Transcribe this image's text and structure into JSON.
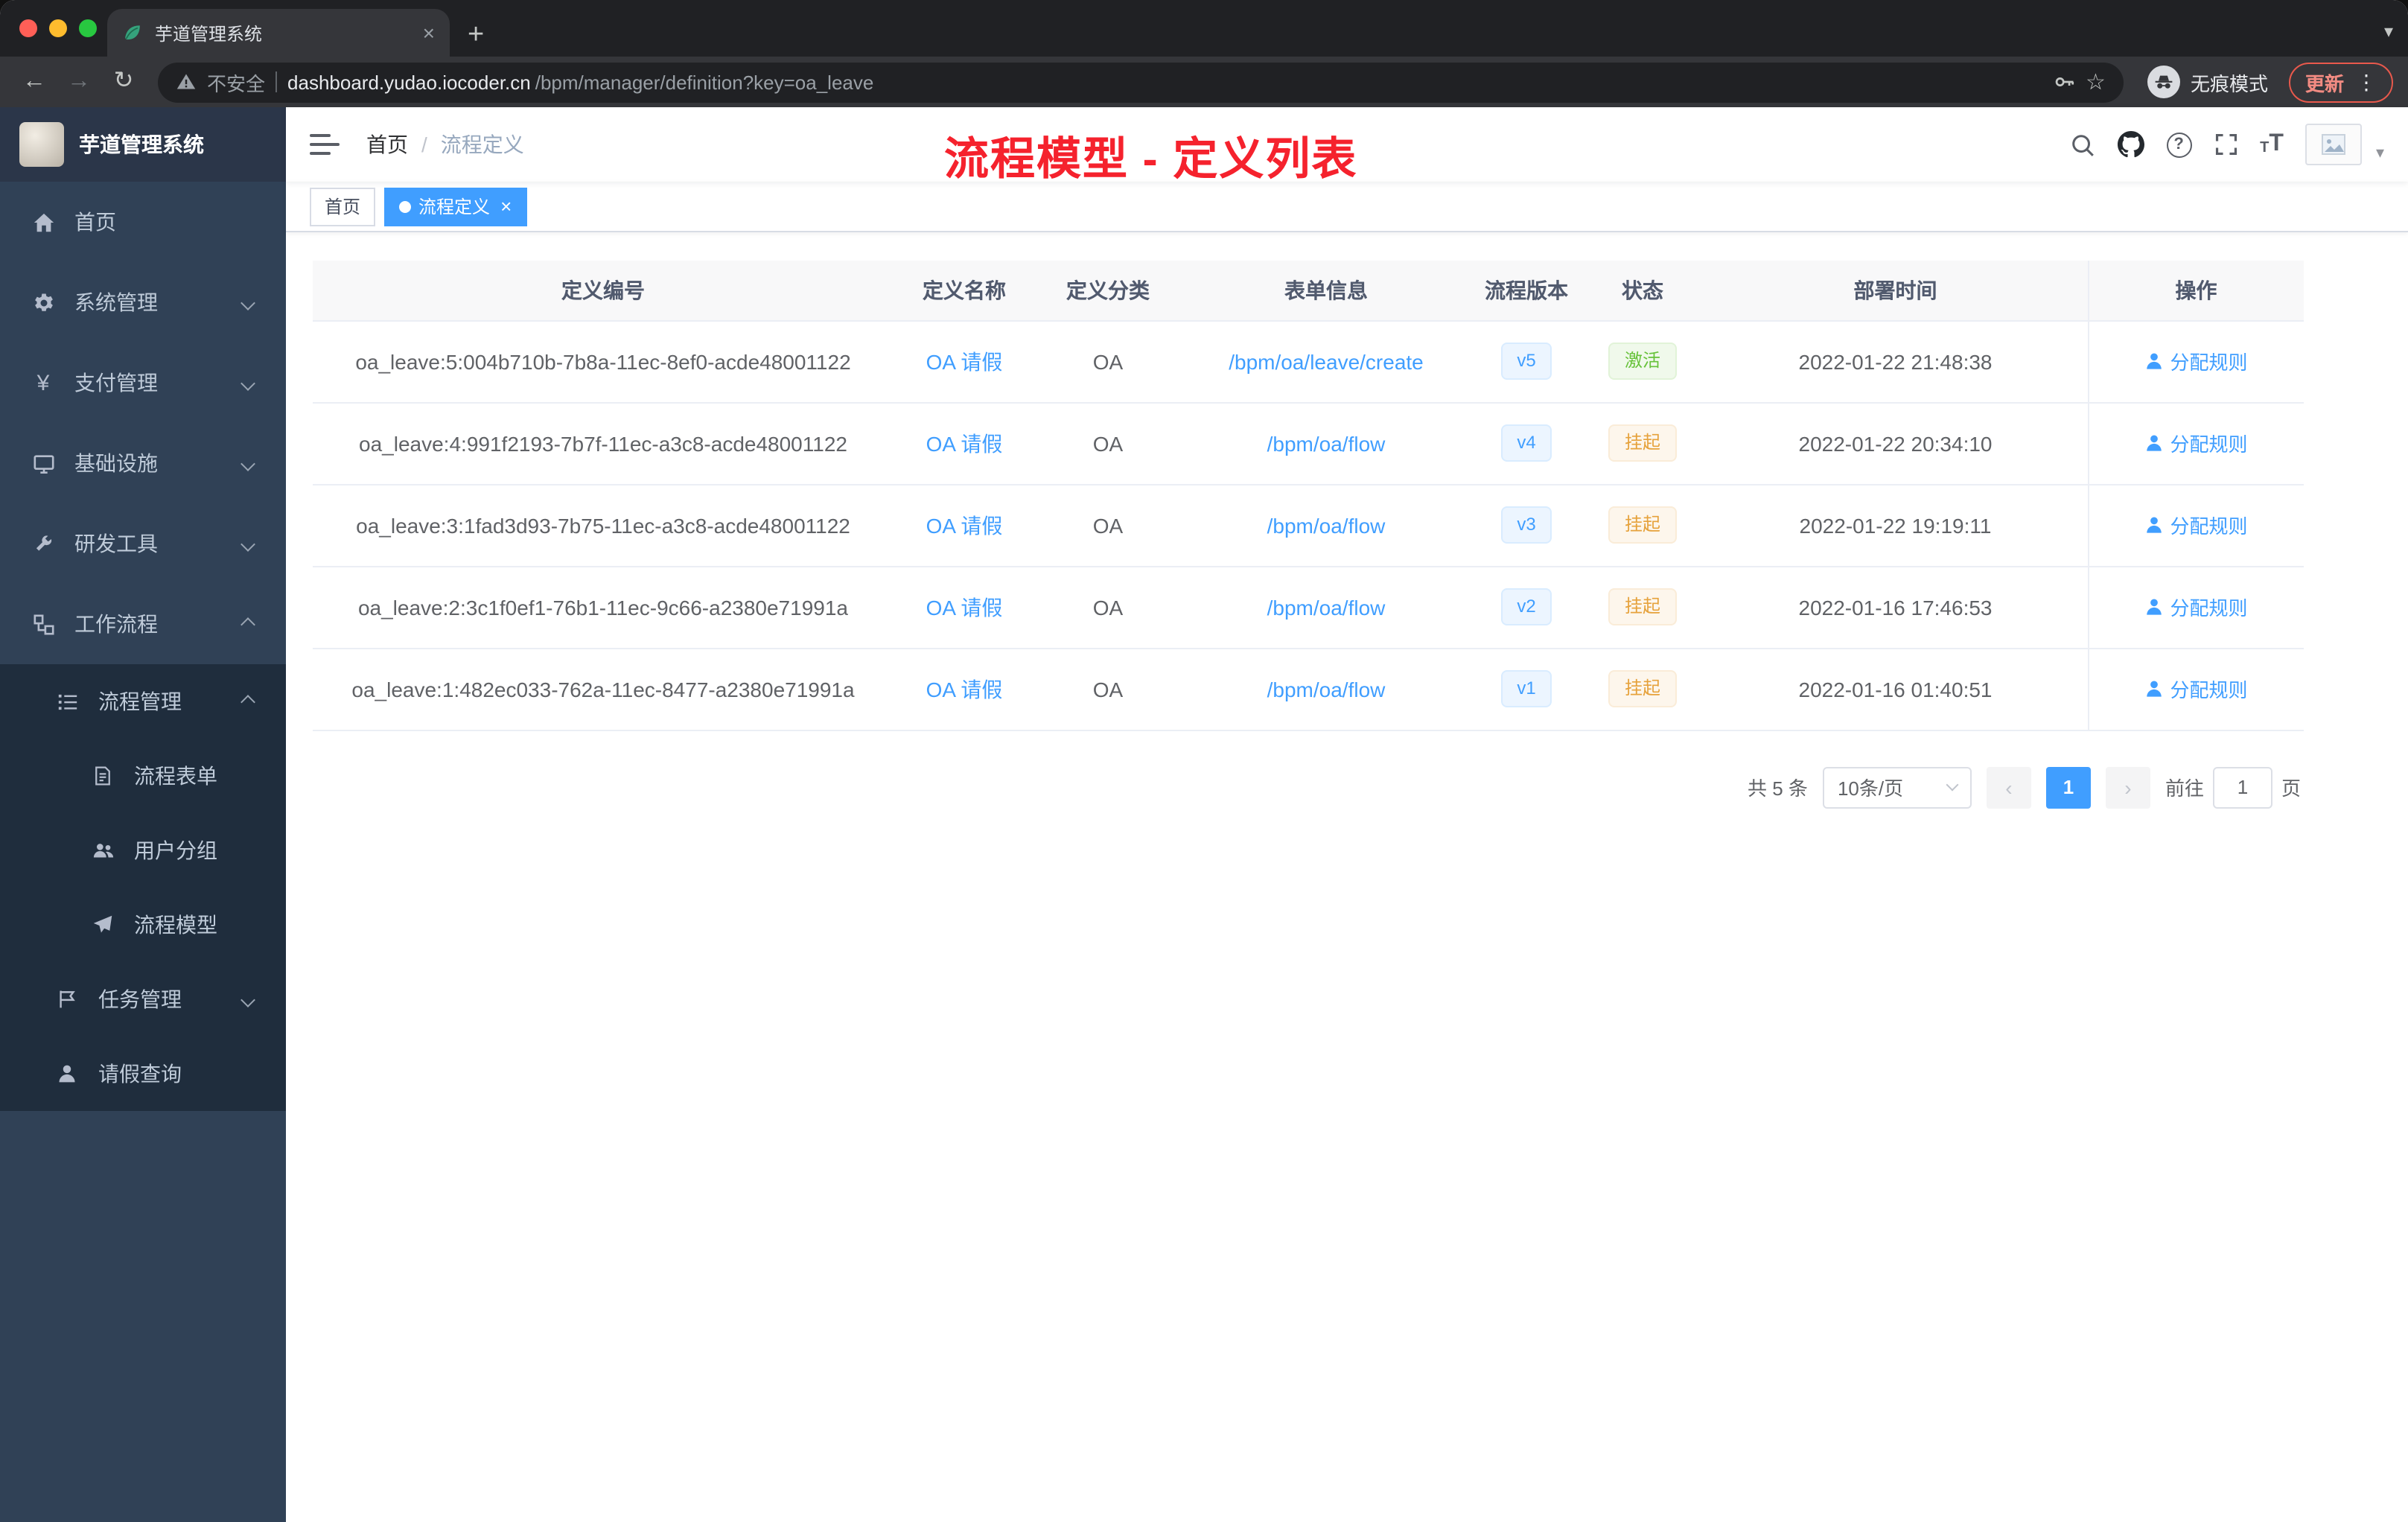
{
  "browser": {
    "tab_title": "芋道管理系统",
    "security_label": "不安全",
    "url_host": "dashboard.yudao.iocoder.cn",
    "url_path": "/bpm/manager/definition?key=oa_leave",
    "incognito_label": "无痕模式",
    "update_label": "更新"
  },
  "glyphs": {
    "back": "←",
    "forward": "→",
    "reload": "↻",
    "plus": "+",
    "close": "×",
    "dots": "⋮",
    "caret": "▾",
    "yen": "¥",
    "star": "☆",
    "question": "?",
    "prev": "‹",
    "next": "›",
    "font_small": "T",
    "font_large": "T"
  },
  "sidebar": {
    "logo_title": "芋道管理系统",
    "menu": {
      "home": "首页",
      "system": "系统管理",
      "payment": "支付管理",
      "infra": "基础设施",
      "devtools": "研发工具",
      "workflow": "工作流程",
      "process_mgmt": "流程管理",
      "process_form": "流程表单",
      "user_group": "用户分组",
      "process_model": "流程模型",
      "task_mgmt": "任务管理",
      "leave_query": "请假查询"
    }
  },
  "navbar": {
    "breadcrumb_home": "首页",
    "breadcrumb_sep": "/",
    "breadcrumb_current": "流程定义",
    "annotation": "流程模型 - 定义列表"
  },
  "tags": [
    {
      "label": "首页",
      "active": false
    },
    {
      "label": "流程定义",
      "active": true
    }
  ],
  "table": {
    "headers": [
      "定义编号",
      "定义名称",
      "定义分类",
      "表单信息",
      "流程版本",
      "状态",
      "部署时间",
      "操作"
    ],
    "rows": [
      {
        "id": "oa_leave:5:004b710b-7b8a-11ec-8ef0-acde48001122",
        "name": "OA 请假",
        "category": "OA",
        "form": "/bpm/oa/leave/create",
        "version": "v5",
        "status": "激活",
        "status_type": "success",
        "deploy_time": "2022-01-22 21:48:38",
        "action": "分配规则"
      },
      {
        "id": "oa_leave:4:991f2193-7b7f-11ec-a3c8-acde48001122",
        "name": "OA 请假",
        "category": "OA",
        "form": "/bpm/oa/flow",
        "version": "v4",
        "status": "挂起",
        "status_type": "warning",
        "deploy_time": "2022-01-22 20:34:10",
        "action": "分配规则"
      },
      {
        "id": "oa_leave:3:1fad3d93-7b75-11ec-a3c8-acde48001122",
        "name": "OA 请假",
        "category": "OA",
        "form": "/bpm/oa/flow",
        "version": "v3",
        "status": "挂起",
        "status_type": "warning",
        "deploy_time": "2022-01-22 19:19:11",
        "action": "分配规则"
      },
      {
        "id": "oa_leave:2:3c1f0ef1-76b1-11ec-9c66-a2380e71991a",
        "name": "OA 请假",
        "category": "OA",
        "form": "/bpm/oa/flow",
        "version": "v2",
        "status": "挂起",
        "status_type": "warning",
        "deploy_time": "2022-01-16 17:46:53",
        "action": "分配规则"
      },
      {
        "id": "oa_leave:1:482ec033-762a-11ec-8477-a2380e71991a",
        "name": "OA 请假",
        "category": "OA",
        "form": "/bpm/oa/flow",
        "version": "v1",
        "status": "挂起",
        "status_type": "warning",
        "deploy_time": "2022-01-16 01:40:51",
        "action": "分配规则"
      }
    ]
  },
  "pagination": {
    "total": "共 5 条",
    "page_size": "10条/页",
    "page": "1",
    "goto_label": "前往",
    "goto_value": "1",
    "goto_unit": "页"
  },
  "colors": {
    "accent_blue": "#409EFF",
    "success_green": "#67C23A",
    "warning_orange": "#E6A23C",
    "annotation_red": "#F5222D",
    "sidebar_bg": "#304156",
    "sidebar_submenu_bg": "#1F2D3D",
    "chrome_dark": "#202124",
    "chrome_toolbar": "#35363A",
    "update_red": "#F28B82",
    "traffic_red": "#FF5F57",
    "traffic_yellow": "#FEBC2E",
    "traffic_green": "#28C840"
  },
  "icon_names": [
    "tab-favicon-leaf",
    "warning-triangle-icon",
    "key-icon",
    "star-icon",
    "incognito-icon",
    "home-icon",
    "gear-icon",
    "yen-icon",
    "server-icon",
    "wrench-icon",
    "workflow-icon",
    "list-icon",
    "form-icon",
    "users-group-icon",
    "send-icon",
    "flag-icon",
    "user-icon",
    "hamburger-icon",
    "search-icon",
    "github-icon",
    "question-icon",
    "fullscreen-icon",
    "font-size-icon",
    "image-placeholder-icon",
    "person-icon"
  ]
}
